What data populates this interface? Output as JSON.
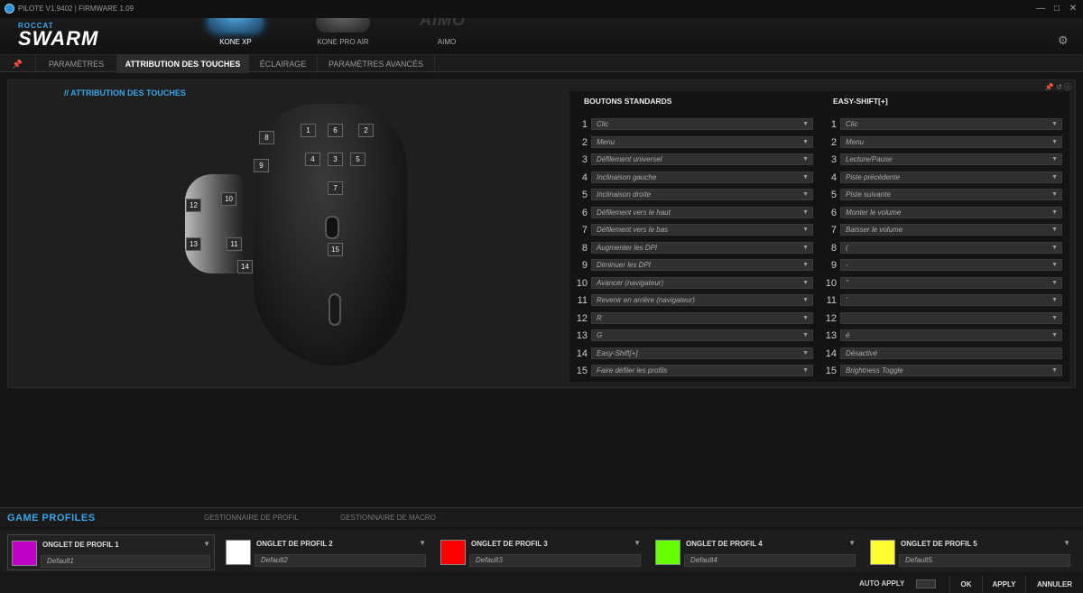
{
  "app": {
    "version": "PILOTE V1.9402 | FIRMWARE 1.09",
    "brand_top": "ROCCAT",
    "brand_main": "SWARM"
  },
  "window": {
    "minimize": "—",
    "maximize": "□",
    "close": "✕"
  },
  "devices": [
    {
      "label": "KONE XP",
      "active": true
    },
    {
      "label": "KONE PRO AIR",
      "active": false
    },
    {
      "label": "AIMO",
      "logo": "AIMO",
      "active": false
    }
  ],
  "tabs": [
    "PARAMÈTRES",
    "ATTRIBUTION DES TOUCHES",
    "ÉCLAIRAGE",
    "PARAMÈTRES AVANCÉS"
  ],
  "panel": {
    "title": "// ATTRIBUTION DES TOUCHES"
  },
  "mouse_labels": [
    "1",
    "2",
    "3",
    "4",
    "5",
    "6",
    "7",
    "8",
    "9",
    "10",
    "11",
    "12",
    "13",
    "14",
    "15"
  ],
  "assign": {
    "std_header": "BOUTONS STANDARDS",
    "es_header": "EASY-SHIFT[+]",
    "rows": [
      {
        "n": "1",
        "std": "Clic",
        "es": "Clic"
      },
      {
        "n": "2",
        "std": "Menu",
        "es": "Menu"
      },
      {
        "n": "3",
        "std": "Défilement universel",
        "es": "Lecture/Pause"
      },
      {
        "n": "4",
        "std": "Inclinaison gauche",
        "es": "Piste précédente"
      },
      {
        "n": "5",
        "std": "Inclinaison droite",
        "es": "Piste suivante"
      },
      {
        "n": "6",
        "std": "Défilement vers le haut",
        "es": "Monter le volume"
      },
      {
        "n": "7",
        "std": "Défilement vers le bas",
        "es": "Baisser le volume"
      },
      {
        "n": "8",
        "std": "Augmenter les DPI",
        "es": "("
      },
      {
        "n": "9",
        "std": "Diminuer les DPI",
        "es": "-"
      },
      {
        "n": "10",
        "std": "Avancer (navigateur)",
        "es": "\""
      },
      {
        "n": "11",
        "std": "Revenir en arrière (navigateur)",
        "es": "'"
      },
      {
        "n": "12",
        "std": "R",
        "es": ""
      },
      {
        "n": "13",
        "std": "G",
        "es": "é"
      },
      {
        "n": "14",
        "std": "Easy-Shift[+]",
        "es": "Désactivé"
      },
      {
        "n": "15",
        "std": "Faire défiler les profils",
        "es": "Brightness Toggle"
      }
    ]
  },
  "game_profiles": {
    "title": "GAME PROFILES",
    "tabs": [
      "GESTIONNAIRE DE PROFIL",
      "GESTIONNAIRE DE MACRO"
    ],
    "profiles": [
      {
        "name": "ONGLET DE PROFIL 1",
        "default": "Default1",
        "color": "#c000c8"
      },
      {
        "name": "ONGLET DE PROFIL 2",
        "default": "Default2",
        "color": "#ffffff"
      },
      {
        "name": "ONGLET DE PROFIL 3",
        "default": "Default3",
        "color": "#ff0000"
      },
      {
        "name": "ONGLET DE PROFIL 4",
        "default": "Default4",
        "color": "#66ff00"
      },
      {
        "name": "ONGLET DE PROFIL 5",
        "default": "Default5",
        "color": "#ffff33"
      }
    ]
  },
  "footer": {
    "auto_apply": "AUTO APPLY",
    "ok": "OK",
    "apply": "APPLY",
    "cancel": "ANNULER"
  }
}
